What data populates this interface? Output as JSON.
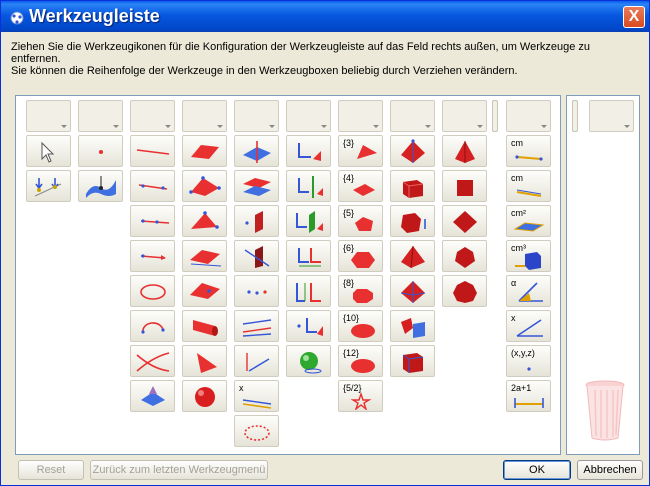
{
  "window": {
    "title": "Werkzeugleiste",
    "close_label": "X"
  },
  "description": {
    "line1": "Ziehen Sie die Werkzeugikonen für die Konfiguration der Werkzeugleiste auf das Feld rechts außen, um Werkzeuge zu entfernen.",
    "line2": "Sie können die Reihenfolge der Werkzeuge in den Werkzeugboxen beliebig durch Verziehen verändern."
  },
  "tool_labels": {
    "poly3": "{3}",
    "poly4": "{4}",
    "poly5": "{5}",
    "poly6": "{6}",
    "poly8": "{8}",
    "poly10": "{10}",
    "poly12": "{12}",
    "poly52": "{5/2}",
    "cm": "cm",
    "cm_b": "cm",
    "cm2": "cm²",
    "cm3": "cm³",
    "alpha": "α",
    "x": "x",
    "xyz": "(x,y,z)",
    "twoaplus1": "2a+1",
    "x2": "x"
  },
  "buttons": {
    "reset": "Reset",
    "back": "Zurück zum letzten Werkzeugmenü",
    "ok": "OK",
    "cancel": "Abbrechen"
  },
  "colors": {
    "accent": "#e83030",
    "blue": "#3556d6",
    "titlebar": "#0758e0"
  }
}
